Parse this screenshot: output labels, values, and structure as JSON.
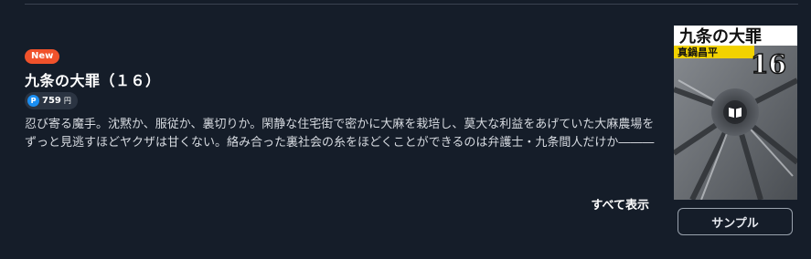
{
  "book": {
    "badge": "New",
    "title": "九条の大罪（１６）",
    "price": {
      "coin_symbol": "P",
      "value": "759",
      "unit": "円"
    },
    "description": "忍び寄る魔手。沈黙か、服従か、裏切りか。閑静な住宅街で密かに大麻を栽培し、莫大な利益をあげていた大麻農場をずっと見逃すほどヤクザは甘くない。絡み合った裏社会の糸をほどくことができるのは弁護士・九条間人だけか―――",
    "show_all_label": "すべて表示",
    "sample_label": "サンプル"
  },
  "cover": {
    "title": "九条の大罪",
    "author": "真鍋昌平",
    "volume": "16",
    "icon": "book-open-icon"
  },
  "colors": {
    "background": "#151d29",
    "new_badge": "#f0522b",
    "coin": "#1a8ef2",
    "author_band": "#f2d200"
  }
}
